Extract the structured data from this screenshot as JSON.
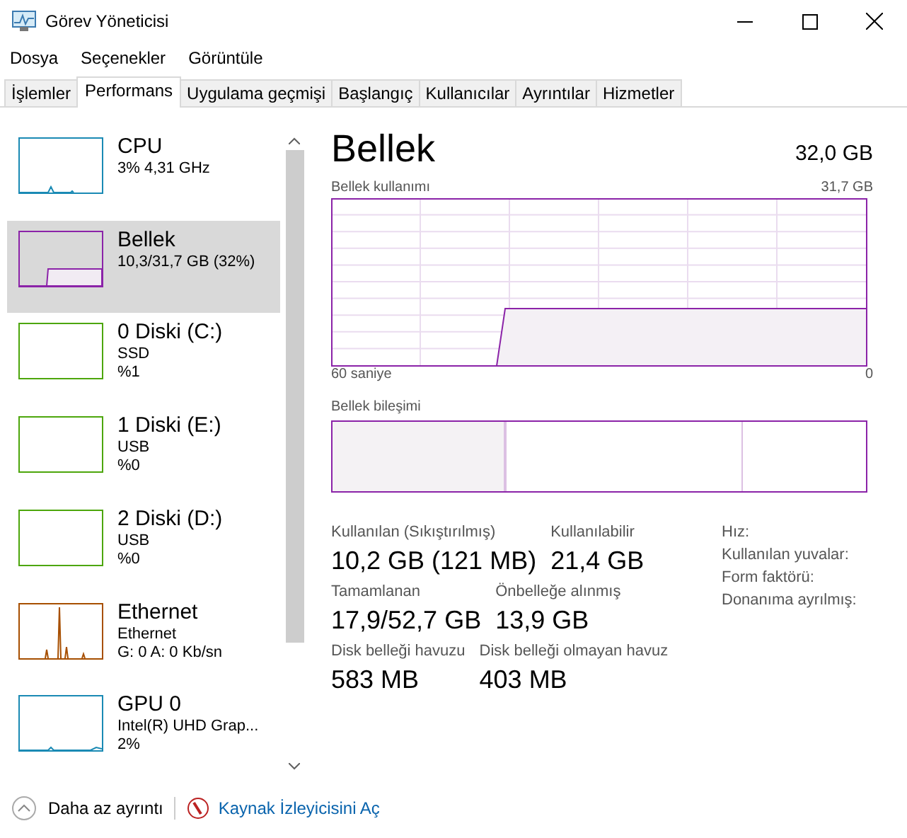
{
  "window": {
    "title": "Görev Yöneticisi"
  },
  "menu": [
    "Dosya",
    "Seçenekler",
    "Görüntüle"
  ],
  "tabs": [
    {
      "label": "İşlemler",
      "selected": false
    },
    {
      "label": "Performans",
      "selected": true
    },
    {
      "label": "Uygulama geçmişi",
      "selected": false
    },
    {
      "label": "Başlangıç",
      "selected": false
    },
    {
      "label": "Kullanıcılar",
      "selected": false
    },
    {
      "label": "Ayrıntılar",
      "selected": false
    },
    {
      "label": "Hizmetler",
      "selected": false
    }
  ],
  "sidebar": {
    "items": [
      {
        "kind": "cpu",
        "name": "CPU",
        "lines": [
          "3% 4,31 GHz"
        ],
        "color": "#1a8ab4",
        "selected": false
      },
      {
        "kind": "memory",
        "name": "Bellek",
        "lines": [
          "10,3/31,7 GB (32%)"
        ],
        "color": "#8b23a8",
        "selected": true
      },
      {
        "kind": "disk",
        "name": "0 Diski (C:)",
        "lines": [
          "SSD",
          "%1"
        ],
        "color": "#4da60c",
        "selected": false
      },
      {
        "kind": "disk",
        "name": "1 Diski (E:)",
        "lines": [
          "USB",
          "%0"
        ],
        "color": "#4da60c",
        "selected": false
      },
      {
        "kind": "disk",
        "name": "2 Diski (D:)",
        "lines": [
          "USB",
          "%0"
        ],
        "color": "#4da60c",
        "selected": false
      },
      {
        "kind": "ethernet",
        "name": "Ethernet",
        "lines": [
          "Ethernet",
          "G: 0 A: 0 Kb/sn"
        ],
        "color": "#a74f01",
        "selected": false
      },
      {
        "kind": "gpu",
        "name": "GPU 0",
        "lines": [
          "Intel(R) UHD Grap...",
          "2%"
        ],
        "color": "#1a8ab4",
        "selected": false
      }
    ]
  },
  "detail": {
    "title": "Bellek",
    "total": "32,0 GB",
    "usage_graph": {
      "label": "Bellek kullanımı",
      "max": "31,7 GB",
      "x_start": "60 saniye",
      "x_end": "0"
    },
    "composition": {
      "label": "Bellek bileşimi"
    },
    "stats": [
      [
        {
          "label": "Kullanılan (Sıkıştırılmış)",
          "value": "10,2 GB (121 MB)"
        },
        {
          "label": "Kullanılabilir",
          "value": "21,4 GB"
        }
      ],
      [
        {
          "label": "Tamamlanan",
          "value": "17,9/52,7 GB"
        },
        {
          "label": "Önbelleğe alınmış",
          "value": "13,9 GB"
        }
      ],
      [
        {
          "label": "Disk belleği havuzu",
          "value": "583 MB"
        },
        {
          "label": "Disk belleği olmayan havuz",
          "value": "403 MB"
        }
      ]
    ],
    "specs": [
      "Hız:",
      "Kullanılan yuvalar:",
      "Form faktörü:",
      "Donanıma ayrılmış:"
    ]
  },
  "footer": {
    "less_details": "Daha az ayrıntı",
    "link": "Kaynak İzleyicisini Aç"
  }
}
